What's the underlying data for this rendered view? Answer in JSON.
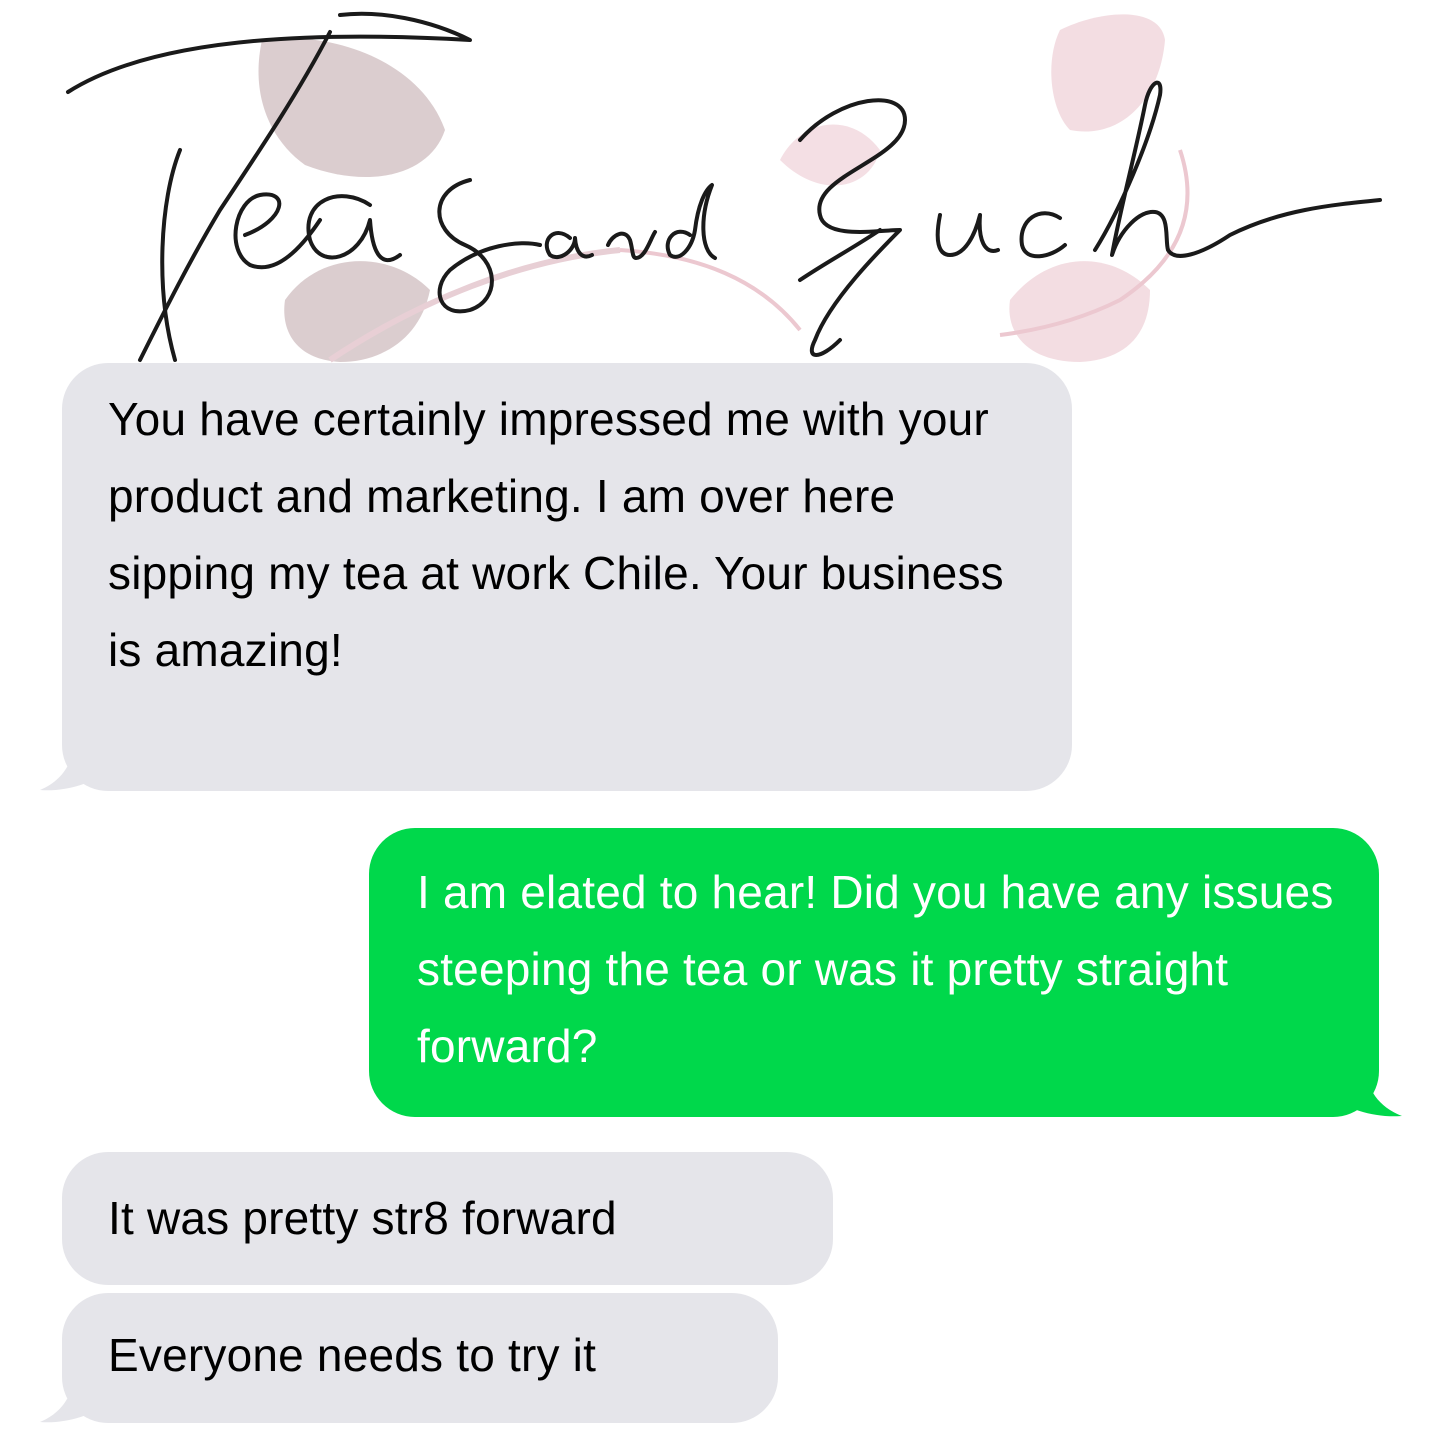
{
  "brand": {
    "logo_text": "Teas and Such",
    "logo_ink_color": "#1a1a1a",
    "leaf_colors": [
      "#cfbcbf",
      "#f1d7dd"
    ]
  },
  "conversation": {
    "messages": [
      {
        "sender": "incoming",
        "text": "You have certainly impressed me with your product and marketing. I am over here sipping my tea at work Chile. Your business is amazing!"
      },
      {
        "sender": "outgoing",
        "text": "I am elated to hear! Did you have any issues steeping the tea or was it pretty straight forward?"
      },
      {
        "sender": "incoming",
        "text": "It was pretty str8 forward"
      },
      {
        "sender": "incoming",
        "text": "Everyone needs to try it"
      }
    ]
  },
  "colors": {
    "incoming_bubble": "#e5e5ea",
    "outgoing_bubble": "#00d84b",
    "incoming_text": "#000000",
    "outgoing_text": "#ffffff"
  }
}
